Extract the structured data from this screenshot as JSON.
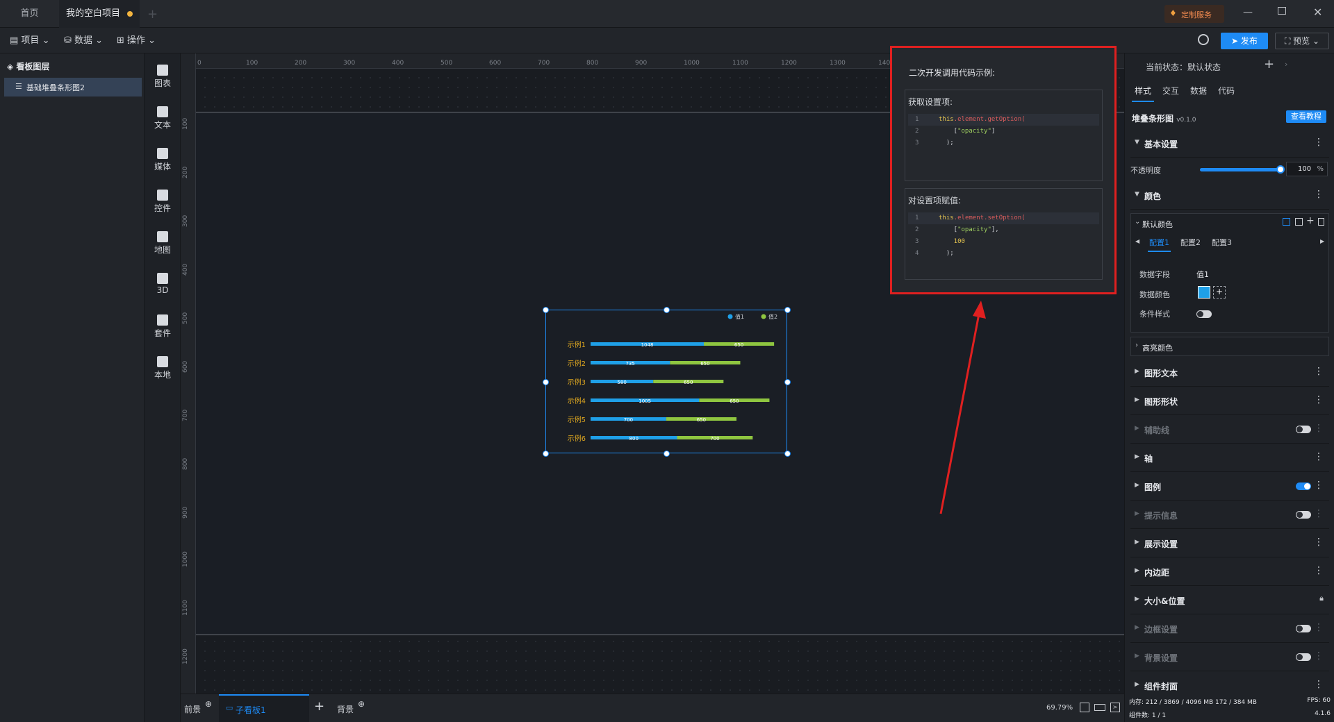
{
  "titlebar": {
    "tabs": [
      {
        "label": "首页"
      },
      {
        "label": "我的空白项目"
      }
    ],
    "service_label": "定制服务"
  },
  "menubar": {
    "items": [
      {
        "label": "项目"
      },
      {
        "label": "数据"
      },
      {
        "label": "操作"
      }
    ],
    "publish_label": "发布",
    "preview_label": "预览"
  },
  "layers": {
    "title": "看板图层",
    "items": [
      {
        "label": "基础堆叠条形图2"
      }
    ]
  },
  "toolrail": {
    "items": [
      {
        "label": "图表",
        "icon": "bar-chart-icon"
      },
      {
        "label": "文本",
        "icon": "text-icon"
      },
      {
        "label": "媒体",
        "icon": "media-icon"
      },
      {
        "label": "控件",
        "icon": "widget-icon"
      },
      {
        "label": "地图",
        "icon": "map-icon"
      },
      {
        "label": "3D",
        "icon": "cube-icon"
      },
      {
        "label": "套件",
        "icon": "kit-icon"
      },
      {
        "label": "本地",
        "icon": "local-icon"
      }
    ]
  },
  "ruler": {
    "top": [
      "0",
      "100",
      "200",
      "300",
      "400",
      "500",
      "600",
      "700",
      "800",
      "900",
      "1000",
      "1100",
      "1200",
      "1300",
      "1400"
    ],
    "left": [
      "100",
      "200",
      "300",
      "400",
      "500",
      "600",
      "700",
      "800",
      "900",
      "1000",
      "1100",
      "1200"
    ]
  },
  "popup": {
    "title": "二次开发调用代码示例:",
    "get_title": "获取设置项:",
    "set_title": "对设置项赋值:",
    "get_lines": [
      {
        "n": "1",
        "parts": [
          [
            "kw",
            "this"
          ],
          [
            "fn",
            ".element.getOption("
          ]
        ]
      },
      {
        "n": "2",
        "parts": [
          [
            "plain",
            "    ["
          ],
          [
            "str",
            "\"opacity\""
          ],
          [
            "plain",
            "]"
          ]
        ]
      },
      {
        "n": "3",
        "parts": [
          [
            "plain",
            "  );"
          ]
        ]
      }
    ],
    "set_lines": [
      {
        "n": "1",
        "parts": [
          [
            "kw",
            "this"
          ],
          [
            "fn",
            ".element.setOption("
          ]
        ]
      },
      {
        "n": "2",
        "parts": [
          [
            "plain",
            "    ["
          ],
          [
            "str",
            "\"opacity\""
          ],
          [
            "plain",
            "],"
          ]
        ]
      },
      {
        "n": "3",
        "parts": [
          [
            "num",
            "    100"
          ]
        ]
      },
      {
        "n": "4",
        "parts": [
          [
            "plain",
            "  );"
          ]
        ]
      }
    ]
  },
  "chart_data": {
    "type": "bar",
    "orientation": "horizontal",
    "stacked": true,
    "categories": [
      "示例1",
      "示例2",
      "示例3",
      "示例4",
      "示例5",
      "示例6"
    ],
    "series": [
      {
        "name": "值1",
        "color": "#1fa0e8",
        "values": [
          1048,
          735,
          580,
          1005,
          700,
          800
        ]
      },
      {
        "name": "值2",
        "color": "#8fc640",
        "values": [
          650,
          650,
          650,
          650,
          650,
          700
        ]
      }
    ],
    "legend_position": "top-right",
    "xlim": [
      0,
      1800
    ]
  },
  "bottombar": {
    "front_label": "前景",
    "board_label": "子看板1",
    "back_label": "背景",
    "zoom": "69.79%"
  },
  "rightpanel": {
    "state_label": "当前状态：默认状态",
    "tabs": [
      "样式",
      "交互",
      "数据",
      "代码"
    ],
    "component_name": "堆叠条形图",
    "version": "v0.1.0",
    "tutorial_label": "查看教程",
    "basic_settings": "基本设置",
    "opacity_label": "不透明度",
    "opacity_value": "100",
    "opacity_unit": "%",
    "opacity_level": 1.0,
    "color_section": "颜色",
    "default_color": "默认颜色",
    "config_tabs": [
      "配置1",
      "配置2",
      "配置3"
    ],
    "data_field_label": "数据字段",
    "data_field_value": "值1",
    "data_color_label": "数据颜色",
    "condition_style_label": "条件样式",
    "highlight_color": "高亮颜色",
    "sections": [
      {
        "label": "图形文本",
        "dim": false,
        "toggle": null,
        "lock": false
      },
      {
        "label": "图形形状",
        "dim": false,
        "toggle": null,
        "lock": false
      },
      {
        "label": "辅助线",
        "dim": true,
        "toggle": "off",
        "lock": false
      },
      {
        "label": "轴",
        "dim": false,
        "toggle": null,
        "lock": false
      },
      {
        "label": "图例",
        "dim": false,
        "toggle": "on",
        "lock": false
      },
      {
        "label": "提示信息",
        "dim": true,
        "toggle": "off",
        "lock": false
      },
      {
        "label": "展示设置",
        "dim": false,
        "toggle": null,
        "lock": false
      },
      {
        "label": "内边距",
        "dim": false,
        "toggle": null,
        "lock": false
      },
      {
        "label": "大小&位置",
        "dim": false,
        "toggle": null,
        "lock": true
      },
      {
        "label": "边框设置",
        "dim": true,
        "toggle": "off",
        "lock": false
      },
      {
        "label": "背景设置",
        "dim": true,
        "toggle": "off",
        "lock": false
      },
      {
        "label": "组件封面",
        "dim": false,
        "toggle": null,
        "lock": false
      }
    ],
    "status_memory": "内存: 212 / 3869 / 4096 MB  172 / 384 MB",
    "status_fps": "FPS: 60",
    "status_components": "组件数: 1 / 1",
    "status_version": "4.1.6"
  },
  "colors": {
    "accent": "#1e8bf5",
    "highlight_box": "#e02020"
  }
}
